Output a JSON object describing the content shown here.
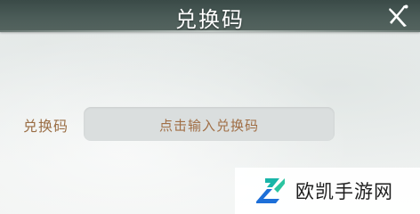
{
  "dialog": {
    "title": "兑换码",
    "close_icon": "close-x-icon"
  },
  "form": {
    "label": "兑换码",
    "input_placeholder": "点击输入兑换码",
    "input_value": ""
  },
  "watermark": {
    "text": "欧凯手游网",
    "logo_icon": "ok-logo-icon"
  },
  "colors": {
    "title_bar": "#4b5c58",
    "label": "#9a6e45",
    "input_bg": "#dadede",
    "logo_teal": "#18b5a8",
    "logo_blue": "#1d6fd8"
  }
}
